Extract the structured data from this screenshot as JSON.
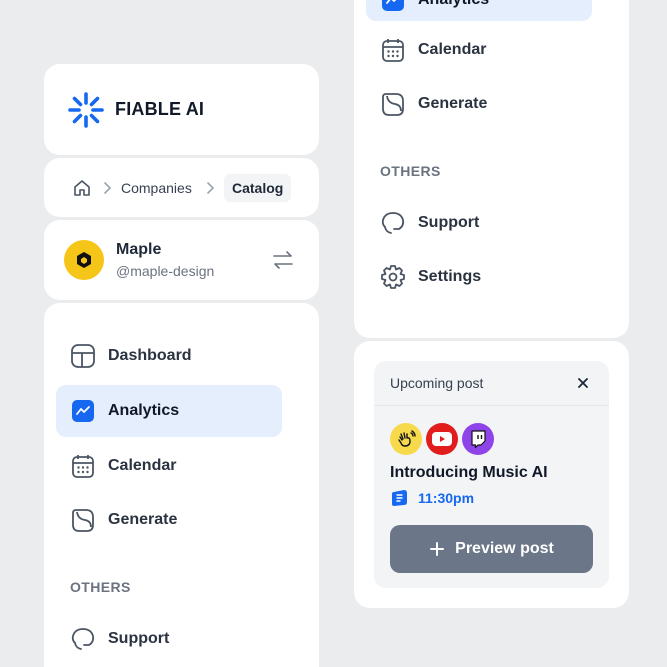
{
  "brand": {
    "name": "FIABLE AI"
  },
  "breadcrumb": {
    "items": [
      "Companies",
      "Catalog"
    ]
  },
  "workspace": {
    "name": "Maple",
    "handle": "@maple-design"
  },
  "nav": {
    "items": [
      {
        "label": "Dashboard",
        "icon": "dashboard-icon"
      },
      {
        "label": "Analytics",
        "icon": "analytics-icon",
        "active": true
      },
      {
        "label": "Calendar",
        "icon": "calendar-icon"
      },
      {
        "label": "Generate",
        "icon": "generate-icon"
      }
    ],
    "others_label": "OTHERS",
    "others": [
      {
        "label": "Support",
        "icon": "support-icon"
      },
      {
        "label": "Settings",
        "icon": "settings-icon"
      }
    ]
  },
  "right_nav": {
    "items": [
      {
        "label": "Analytics",
        "icon": "analytics-icon",
        "active": true
      },
      {
        "label": "Calendar",
        "icon": "calendar-icon"
      },
      {
        "label": "Generate",
        "icon": "generate-icon"
      }
    ],
    "others_label": "OTHERS",
    "others": [
      {
        "label": "Support",
        "icon": "support-icon"
      },
      {
        "label": "Settings",
        "icon": "settings-icon"
      }
    ]
  },
  "upcoming": {
    "header": "Upcoming post",
    "title": "Introducing Music AI",
    "time": "11:30pm",
    "cta": "Preview post",
    "platforms": [
      "hand-wave-icon",
      "youtube-icon",
      "twitch-icon"
    ]
  },
  "colors": {
    "accent": "#1668F0",
    "active_bg": "#E5EEFC",
    "cta_bg": "#6B7689",
    "page_bg": "#EBECEE"
  }
}
